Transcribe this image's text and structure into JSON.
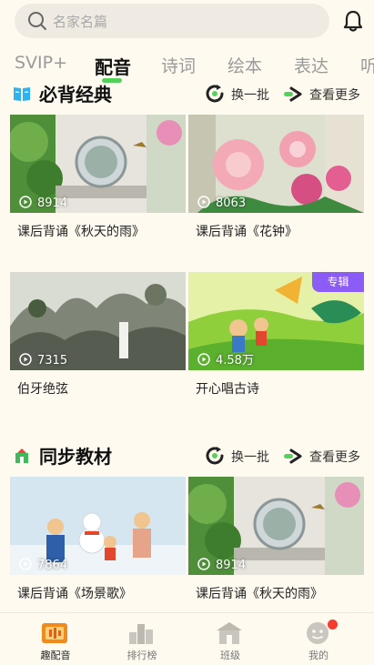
{
  "search": {
    "placeholder": "名家名篇",
    "icon": "search-icon"
  },
  "header": {
    "notification_icon": "bell-icon"
  },
  "tabs": [
    {
      "label": "SVIP+",
      "active": false
    },
    {
      "label": "配音",
      "active": true
    },
    {
      "label": "诗词",
      "active": false
    },
    {
      "label": "绘本",
      "active": false
    },
    {
      "label": "表达",
      "active": false
    },
    {
      "label": "听",
      "active": false
    }
  ],
  "sections": [
    {
      "title": "必背经典",
      "icon": "book-icon",
      "refresh_label": "换一批",
      "more_label": "查看更多",
      "cards": [
        {
          "title": "课后背诵《秋天的雨》",
          "plays": "8914",
          "badge": ""
        },
        {
          "title": "课后背诵《花钟》",
          "plays": "8063",
          "badge": ""
        },
        {
          "title": "伯牙绝弦",
          "plays": "7315",
          "badge": ""
        },
        {
          "title": "开心唱古诗",
          "plays": "4.58万",
          "badge": "专辑"
        }
      ]
    },
    {
      "title": "同步教材",
      "icon": "school-icon",
      "refresh_label": "换一批",
      "more_label": "查看更多",
      "cards": [
        {
          "title": "课后背诵《场景歌》",
          "plays": "7864",
          "badge": ""
        },
        {
          "title": "课后背诵《秋天的雨》",
          "plays": "8914",
          "badge": ""
        }
      ]
    }
  ],
  "bottom_nav": [
    {
      "label": "趣配音",
      "icon": "dub-icon",
      "active": true
    },
    {
      "label": "排行榜",
      "icon": "ranking-icon",
      "active": false
    },
    {
      "label": "班级",
      "icon": "class-icon",
      "active": false
    },
    {
      "label": "我的",
      "icon": "profile-icon",
      "active": false,
      "has_dot": true
    }
  ],
  "colors": {
    "accent": "#55d15b",
    "badge": "#8c5cf6",
    "background": "#fffaf0",
    "dot": "#f33d2e"
  }
}
